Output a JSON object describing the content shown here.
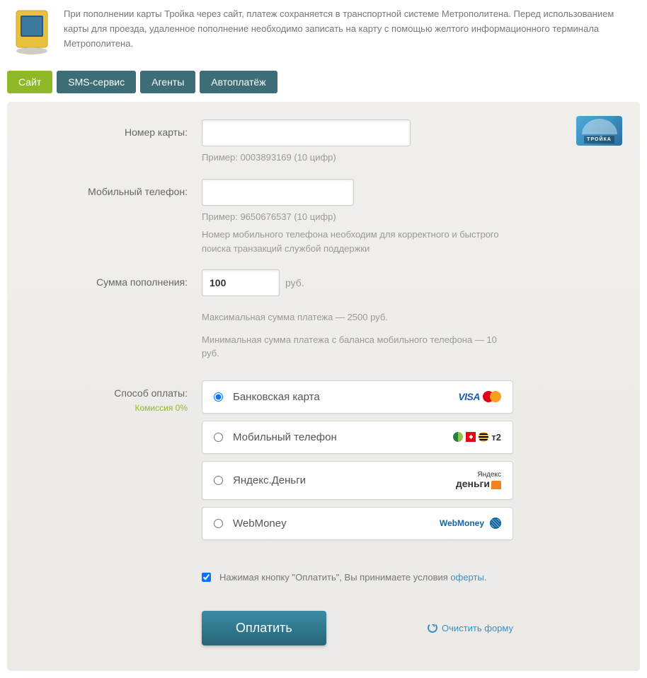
{
  "info_text": "При пополнении карты Тройка через сайт, платеж сохраняется в транспортной системе Метрополитена. Перед использованием карты для проезда, удаленное пополнение необходимо записать на карту с помощью желтого информационного терминала Метрополитена.",
  "tabs": [
    {
      "label": "Сайт",
      "active": true
    },
    {
      "label": "SMS-сервис",
      "active": false
    },
    {
      "label": "Агенты",
      "active": false
    },
    {
      "label": "Автоплатёж",
      "active": false
    }
  ],
  "troika_card_label": "ТРОЙКА",
  "form": {
    "card_number": {
      "label": "Номер карты:",
      "value": "",
      "hint": "Пример: 0003893169 (10 цифр)"
    },
    "phone": {
      "label": "Мобильный телефон:",
      "value": "",
      "hint1": "Пример: 9650676537 (10 цифр)",
      "hint2": "Номер мобильного телефона необходим для корректного и быстрого поиска транзакций службой поддержки"
    },
    "amount": {
      "label": "Сумма пополнения:",
      "value": "100",
      "unit": "руб.",
      "hint1": "Максимальная сумма платежа — 2500 руб.",
      "hint2": "Минимальная сумма платежа с баланса мобильного телефона — 10 руб."
    },
    "payment_method": {
      "label": "Способ оплаты:",
      "commission": "Комиссия 0%",
      "options": [
        {
          "label": "Банковская карта",
          "selected": true
        },
        {
          "label": "Мобильный телефон",
          "selected": false
        },
        {
          "label": "Яндекс.Деньги",
          "selected": false
        },
        {
          "label": "WebMoney",
          "selected": false
        }
      ]
    },
    "agree": {
      "checked": true,
      "text_before": "Нажимая кнопку \"Оплатить\", Вы принимаете условия ",
      "link": "оферты",
      "text_after": "."
    },
    "submit_label": "Оплатить",
    "clear_label": "Очистить форму"
  },
  "icons": {
    "visa": "VISA",
    "t2": "т2",
    "yandex_small": "Яндекс",
    "yandex_big": "деньги",
    "webmoney": "WebMoney"
  }
}
